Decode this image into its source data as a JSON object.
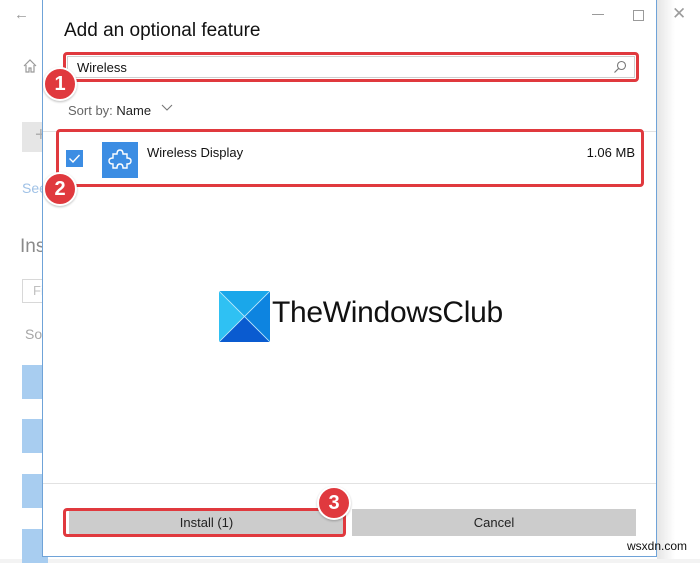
{
  "background_window": {
    "back_icon": "arrow-left-icon",
    "home_icon": "home-icon",
    "add_icon": "plus-icon",
    "see_link_fragment": "See",
    "section_heading_fragment": "Ins",
    "find_input_fragment": "Fi",
    "sort_fragment": "So",
    "close_icon": "close-icon"
  },
  "dialog": {
    "title": "Add an optional feature",
    "window_controls": {
      "minimize": "minimize-icon",
      "maximize": "maximize-icon"
    },
    "search": {
      "value": "Wireless",
      "icon": "search-icon"
    },
    "sort": {
      "label": "Sort by:",
      "value": "Name",
      "icon": "chevron-down-icon"
    },
    "features": [
      {
        "name": "Wireless Display",
        "size": "1.06 MB",
        "checked": true,
        "icon": "puzzle-piece-icon"
      }
    ],
    "buttons": {
      "install": "Install (1)",
      "cancel": "Cancel"
    }
  },
  "annotations": {
    "color": "#e0393e",
    "badges": [
      "1",
      "2",
      "3"
    ]
  },
  "watermarks": {
    "brand": "TheWindowsClub",
    "site": "wsxdn.com"
  },
  "colors": {
    "accent": "#3c8de3",
    "dialog_border": "#6fa3d8",
    "button_bg": "#cccccc"
  }
}
